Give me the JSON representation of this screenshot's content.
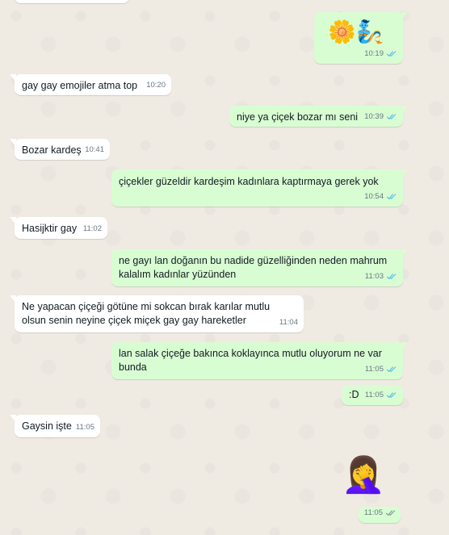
{
  "messages": [
    {
      "dir": "out",
      "emoji": "🌼🧞",
      "time": "10:19"
    },
    {
      "dir": "in",
      "text": "gay gay emojiler atma top",
      "time": "10:20"
    },
    {
      "dir": "out",
      "text": "niye ya çiçek bozar mı seni",
      "time": "10:39"
    },
    {
      "dir": "in",
      "text": "Bozar kardeş",
      "time": "10:41"
    },
    {
      "dir": "out",
      "text": "çiçekler güzeldir kardeşim kadınlara kaptırmaya gerek yok",
      "time": "10:54"
    },
    {
      "dir": "in",
      "text": "Hasijktir gay",
      "time": "11:02"
    },
    {
      "dir": "out",
      "text_lines": [
        "ne gayı lan doğanın bu nadide güzelliğinden neden mahrum",
        "kalalım kadınlar yüzünden"
      ],
      "time": "11:03"
    },
    {
      "dir": "in",
      "text_lines": [
        "Ne yapacan çiçeği götüne mi sokcan bırak karılar mutlu",
        "olsun senin neyine çiçek miçek gay gay hareketler"
      ],
      "time": "11:04"
    },
    {
      "dir": "out",
      "text_lines": [
        "lan salak çiçeğe bakınca koklayınca mutlu oluyorum ne var",
        "bunda"
      ],
      "time": "11:05"
    },
    {
      "dir": "out",
      "text": ":D",
      "time": "11:05"
    },
    {
      "dir": "in",
      "text": "Gaysin işte",
      "time": "11:05"
    },
    {
      "dir": "out",
      "emoji": "🤦‍♀️",
      "time": "11:05"
    }
  ],
  "colors": {
    "incoming": "#ffffff",
    "outgoing": "#d9fdd3",
    "read_ticks": "#53bdeb",
    "background": "#efeae2"
  },
  "icons": {
    "ticks": "double-check-icon"
  }
}
